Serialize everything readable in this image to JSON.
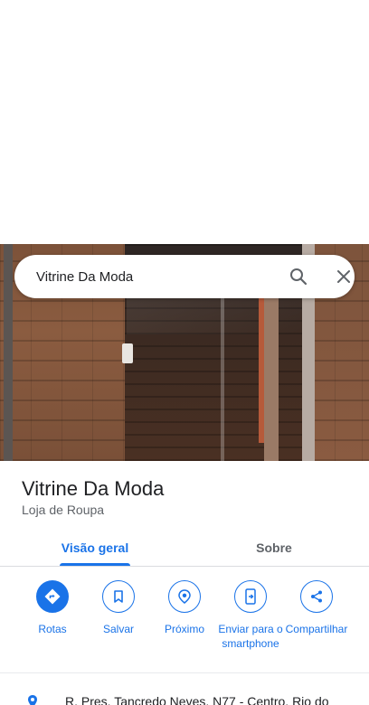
{
  "search": {
    "query": "Vitrine Da Moda"
  },
  "place": {
    "name": "Vitrine Da Moda",
    "category": "Loja de Roupa",
    "address": "R. Pres. Tancredo Neves, N77 - Centro, Rio do"
  },
  "tabs": [
    {
      "label": "Visão geral",
      "active": true
    },
    {
      "label": "Sobre",
      "active": false
    }
  ],
  "actions": [
    {
      "label": "Rotas",
      "icon": "directions-icon"
    },
    {
      "label": "Salvar",
      "icon": "bookmark-icon"
    },
    {
      "label": "Próximo",
      "icon": "nearby-icon"
    },
    {
      "label": "Enviar para o smartphone",
      "icon": "send-to-phone-icon"
    },
    {
      "label": "Compartilhar",
      "icon": "share-icon"
    }
  ],
  "colors": {
    "accent": "#1a73e8",
    "text": "#202124",
    "secondary_text": "#5f6368"
  }
}
